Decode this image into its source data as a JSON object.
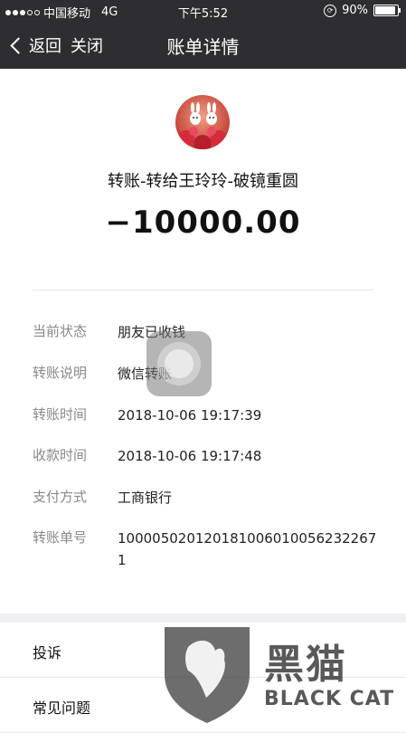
{
  "status_bar": {
    "carrier": "中国移动",
    "network": "4G",
    "time": "下午5:52",
    "battery": "90%",
    "battery_level": 0.9
  },
  "nav": {
    "back_label": "返回",
    "close_label": "关闭",
    "title": "账单详情"
  },
  "bill": {
    "title": "转账-转给王玲玲-破镜重圆",
    "amount": "−10000.00"
  },
  "details": [
    {
      "label": "当前状态",
      "value": "朋友已收钱"
    },
    {
      "label": "转账说明",
      "value": "微信转账"
    },
    {
      "label": "转账时间",
      "value": "2018-10-06 19:17:39"
    },
    {
      "label": "收款时间",
      "value": "2018-10-06 19:17:48"
    },
    {
      "label": "支付方式",
      "value": "工商银行"
    },
    {
      "label": "转账单号",
      "value": "1000050201201810060100562322671"
    }
  ],
  "menu": [
    {
      "label": "投诉"
    },
    {
      "label": "常见问题"
    }
  ],
  "watermark": {
    "cn": "黑猫",
    "en": "BLACK CAT"
  }
}
